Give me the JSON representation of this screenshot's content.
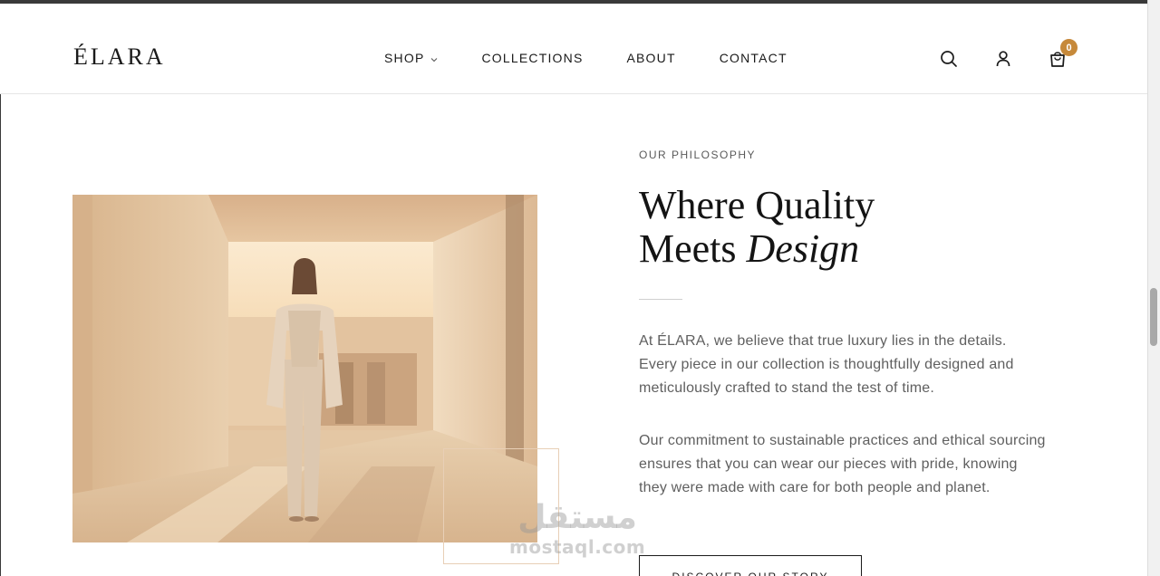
{
  "brand": {
    "logo": "ÉLARA"
  },
  "nav": {
    "items": [
      {
        "label": "SHOP",
        "has_dropdown": true
      },
      {
        "label": "COLLECTIONS"
      },
      {
        "label": "ABOUT"
      },
      {
        "label": "CONTACT"
      }
    ]
  },
  "header_icons": [
    "search-icon",
    "user-icon",
    "shopping-bag-icon"
  ],
  "cart": {
    "count": "0"
  },
  "section": {
    "eyebrow": "OUR PHILOSOPHY",
    "headline_line1": "Where Quality",
    "headline_line2_plain": "Meets ",
    "headline_line2_italic": "Design",
    "paragraph1": "At ÉLARA, we believe that true luxury lies in the details. Every piece in our collection is thoughtfully designed and meticulously crafted to stand the test of time.",
    "paragraph2": "Our commitment to sustainable practices and ethical sourcing ensures that you can wear our pieces with pride, knowing they were made with care for both people and planet.",
    "cta_label": "DISCOVER OUR STORY"
  },
  "watermark": {
    "arabic": "مستقل",
    "latin": "mostaql.com"
  },
  "colors": {
    "accent": "#c6893a",
    "text": "#1a1a1a",
    "muted": "#5f5f5f",
    "frame": "#e8cfb6"
  }
}
